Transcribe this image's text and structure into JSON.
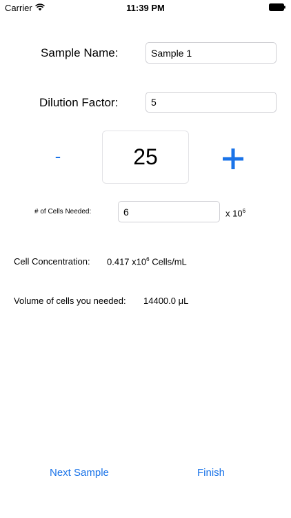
{
  "status_bar": {
    "carrier": "Carrier",
    "time": "11:39 PM",
    "wifi_icon": "wifi-icon",
    "battery_icon": "battery-icon"
  },
  "sample_name": {
    "label": "Sample Name:",
    "value": "Sample 1"
  },
  "dilution": {
    "label": "Dilution Factor:",
    "value": "5"
  },
  "counter": {
    "minus_label": "-",
    "value": "25",
    "plus_icon": "plus-icon"
  },
  "cells_needed": {
    "label": "# of Cells Needed:",
    "value": "6",
    "unit_prefix": "x 10",
    "unit_exponent": "6"
  },
  "concentration": {
    "label": "Cell Concentration:",
    "value": "0.417 x10",
    "exponent": "6",
    "unit": "Cells/mL"
  },
  "volume": {
    "label": "Volume of cells you needed:",
    "value": "14400.0 μL"
  },
  "bottom": {
    "next_sample": "Next Sample",
    "finish": "Finish"
  },
  "colors": {
    "accent": "#1a73e8",
    "border": "#cfcfd4"
  }
}
